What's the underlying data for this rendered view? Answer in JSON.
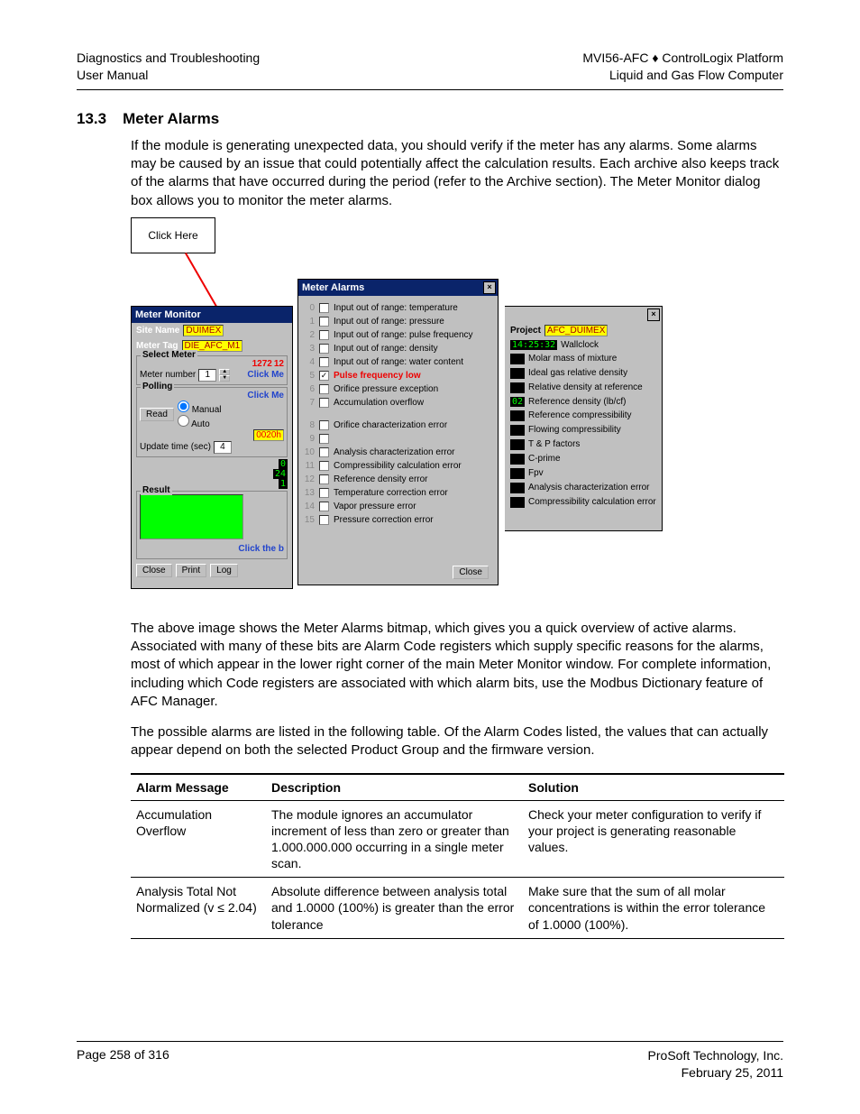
{
  "header": {
    "left1": "Diagnostics and Troubleshooting",
    "left2": "User Manual",
    "right1": "MVI56-AFC ♦ ControlLogix Platform",
    "right2": "Liquid and Gas Flow Computer"
  },
  "section": {
    "num": "13.3",
    "title": "Meter Alarms"
  },
  "para1": "If the module is generating unexpected data, you should verify if the meter has any alarms. Some alarms may be caused by an issue that could potentially affect the calculation results. Each archive also keeps track of the alarms that have occurred during the period (refer to the Archive section). The Meter Monitor dialog box allows you to monitor the meter alarms.",
  "callout": "Click Here",
  "mm": {
    "title": "Meter Monitor",
    "siteNameLabel": "Site Name",
    "siteName": "DUIMEX",
    "meterTagLabel": "Meter Tag",
    "meterTag": "DIE_AFC_M1",
    "selectLegend": "Select Meter",
    "meterNumberLabel": "Meter number",
    "meterNumber": "1",
    "r1": "1272",
    "r2": "12",
    "clickMe1": "Click Me",
    "pollingLegend": "Polling",
    "read": "Read",
    "manual": "Manual",
    "auto": "Auto",
    "clickMe2": "Click Me",
    "hex0020": "0020h",
    "updateLabel": "Update time (sec)",
    "updateVal": "4",
    "g0": "0",
    "g24": "24",
    "g1": "1",
    "resultLegend": "Result",
    "clickTheB": "Click the b",
    "close": "Close",
    "print": "Print",
    "log": "Log"
  },
  "alarmsDlg": {
    "title": "Meter Alarms",
    "rows": [
      {
        "n": "0",
        "txt": "Input out of range: temperature",
        "chk": false,
        "red": false
      },
      {
        "n": "1",
        "txt": "Input out of range: pressure",
        "chk": false,
        "red": false
      },
      {
        "n": "2",
        "txt": "Input out of range: pulse frequency",
        "chk": false,
        "red": false
      },
      {
        "n": "3",
        "txt": "Input out of range: density",
        "chk": false,
        "red": false
      },
      {
        "n": "4",
        "txt": "Input out of range: water content",
        "chk": false,
        "red": false
      },
      {
        "n": "5",
        "txt": "Pulse frequency low",
        "chk": true,
        "red": true
      },
      {
        "n": "6",
        "txt": "Orifice pressure exception",
        "chk": false,
        "red": false
      },
      {
        "n": "7",
        "txt": "Accumulation overflow",
        "chk": false,
        "red": false
      },
      {
        "n": "8",
        "txt": "Orifice characterization error",
        "chk": false,
        "red": false
      },
      {
        "n": "9",
        "txt": "",
        "chk": false,
        "red": false
      },
      {
        "n": "10",
        "txt": "Analysis characterization error",
        "chk": false,
        "red": false
      },
      {
        "n": "11",
        "txt": "Compressibility calculation error",
        "chk": false,
        "red": false
      },
      {
        "n": "12",
        "txt": "Reference density error",
        "chk": false,
        "red": false
      },
      {
        "n": "13",
        "txt": "Temperature correction error",
        "chk": false,
        "red": false
      },
      {
        "n": "14",
        "txt": "Vapor pressure error",
        "chk": false,
        "red": false
      },
      {
        "n": "15",
        "txt": "Pressure correction error",
        "chk": false,
        "red": false
      }
    ],
    "close": "Close"
  },
  "proj": {
    "projectLabel": "Project",
    "projectVal": "AFC_DUIMEX",
    "clock": "14:25:32",
    "wallclock": "Wallclock",
    "green02": "02",
    "items": [
      "Molar mass of mixture",
      "Ideal gas relative density",
      "Relative density at reference",
      "Reference density (lb/cf)",
      "Reference compressibility",
      "Flowing compressibility",
      "T & P factors",
      "C-prime",
      "Fpv",
      "Analysis characterization error",
      "Compressibility calculation error"
    ]
  },
  "para2": "The above image shows the Meter Alarms bitmap, which gives you a quick overview of active alarms. Associated with many of these bits are Alarm Code registers which supply specific reasons for the alarms, most of which appear in the lower right corner of the main Meter Monitor window. For complete information, including which Code registers are associated with which alarm bits, use the Modbus Dictionary feature of AFC Manager.",
  "para3": "The possible alarms are listed in the following table. Of the Alarm Codes listed, the values that can actually appear depend on both the selected Product Group and the firmware version.",
  "table": {
    "headers": [
      "Alarm Message",
      "Description",
      "Solution"
    ],
    "rows": [
      {
        "msg": "Accumulation Overflow",
        "desc": "The module ignores an accumulator increment of less than zero or greater than 1.000.000.000 occurring in a single meter scan.",
        "sol": "Check your meter configuration to verify if your project is generating reasonable values."
      },
      {
        "msg": "Analysis Total Not Normalized (v ≤ 2.04)",
        "desc": "Absolute difference between analysis total and 1.0000 (100%) is greater than the error tolerance",
        "sol": "Make sure that the sum of all molar concentrations is within the error tolerance of 1.0000 (100%)."
      }
    ]
  },
  "footer": {
    "left": "Page 258 of 316",
    "right1": "ProSoft Technology, Inc.",
    "right2": "February 25, 2011"
  }
}
